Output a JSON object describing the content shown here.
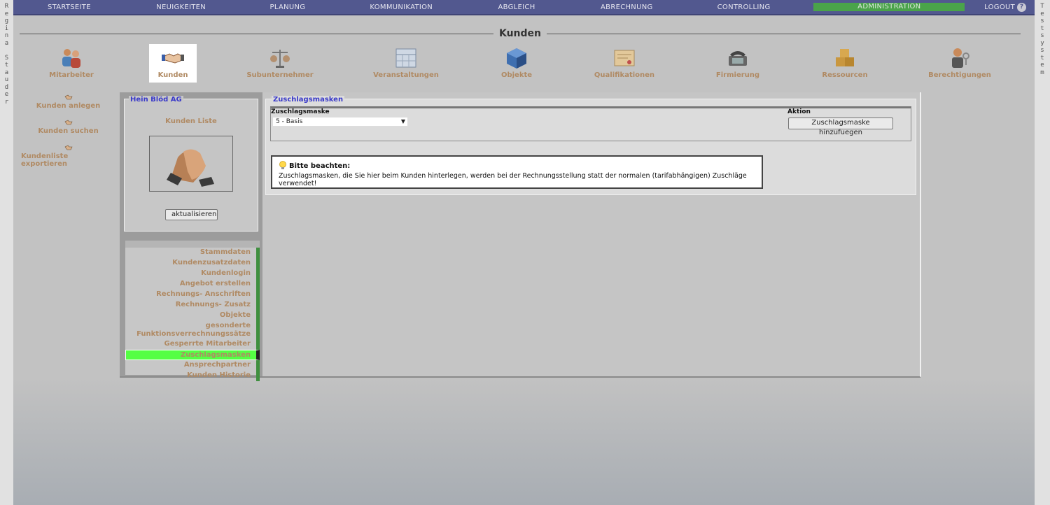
{
  "side_left": [
    "R",
    "e",
    "g",
    "i",
    "n",
    "a",
    " ",
    "S",
    "t",
    "a",
    "u",
    "d",
    "e",
    "r"
  ],
  "side_right": [
    "T",
    "e",
    "s",
    "t",
    "s",
    "y",
    "s",
    "t",
    "e",
    "m"
  ],
  "nav": {
    "items": [
      {
        "label": "STARTSEITE"
      },
      {
        "label": "NEUIGKEITEN"
      },
      {
        "label": "PLANUNG"
      },
      {
        "label": "KOMMUNIKATION"
      },
      {
        "label": "ABGLEICH"
      },
      {
        "label": "ABRECHNUNG"
      },
      {
        "label": "CONTROLLING"
      },
      {
        "label": "ADMINISTRATION"
      },
      {
        "label": "LOGOUT"
      }
    ],
    "active": "ADMINISTRATION",
    "help_symbol": "?"
  },
  "page_title": "Kunden",
  "modules": [
    {
      "label": "Mitarbeiter",
      "icon": "people-icon"
    },
    {
      "label": "Kunden",
      "icon": "handshake-icon"
    },
    {
      "label": "Subunternehmer",
      "icon": "scale-icon"
    },
    {
      "label": "Veranstaltungen",
      "icon": "calendar-icon"
    },
    {
      "label": "Objekte",
      "icon": "cube-icon"
    },
    {
      "label": "Qualifikationen",
      "icon": "certificate-icon"
    },
    {
      "label": "Firmierung",
      "icon": "phone-icon"
    },
    {
      "label": "Ressourcen",
      "icon": "boxes-icon"
    },
    {
      "label": "Berechtigungen",
      "icon": "user-key-icon"
    }
  ],
  "actions": [
    {
      "label": "Kunden anlegen"
    },
    {
      "label": "Kunden suchen"
    },
    {
      "label": "Kundenliste exportieren"
    }
  ],
  "customer": {
    "legend": "Hein Blöd AG",
    "list_label": "Kunden Liste",
    "refresh_label": "aktualisieren"
  },
  "menu": [
    {
      "label": "Stammdaten"
    },
    {
      "label": "Kundenzusatzdaten"
    },
    {
      "label": "Kundenlogin"
    },
    {
      "label": "Angebot erstellen"
    },
    {
      "label": "Rechnungs- Anschriften"
    },
    {
      "label": "Rechnungs- Zusatz"
    },
    {
      "label": "Objekte"
    },
    {
      "label": "gesonderte Funktionsverrechnungssätze"
    },
    {
      "label": "Gesperrte Mitarbeiter"
    },
    {
      "label": "Zuschlagsmasken"
    },
    {
      "label": "Ansprechpartner"
    },
    {
      "label": "Kunden Historie"
    }
  ],
  "menu_active": "Zuschlagsmasken",
  "main": {
    "legend": "Zuschlagsmasken",
    "col_mask": "Zuschlagsmaske",
    "col_action": "Aktion",
    "select_value": "5 - Basis",
    "add_button": "Zuschlagsmaske hinzufuegen",
    "note_title": "Bitte beachten:",
    "note_text": "Zuschlagsmasken, die Sie hier beim Kunden hinterlegen, werden bei der Rechnungsstellung statt der normalen (tarifabhängigen) Zuschläge verwendet!"
  },
  "colors": {
    "nav_bg": "#52588f",
    "active_green": "#55ff44",
    "label_brown": "#b08a63",
    "legend_blue": "#3a3ac9"
  }
}
